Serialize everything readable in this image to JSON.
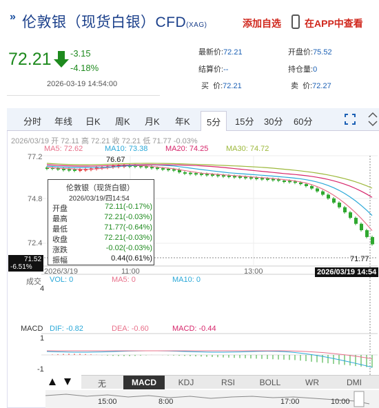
{
  "header": {
    "chevron": "»",
    "title": "伦敦银（现货白银）CFD",
    "title_suffix": "(XAG)",
    "add_fav": "添加自选",
    "app_view": "在APP中查看"
  },
  "quote": {
    "price": "72.21",
    "change": "-3.15",
    "change_pct": "-4.18%",
    "timestamp": "2026-03-19 14:54:00"
  },
  "stats": {
    "latest_label": "最新价:",
    "latest": "72.21",
    "open_label": "开盘价:",
    "open": "75.52",
    "settle_label": "结算价:",
    "settle": "--",
    "oi_label": "持仓量:",
    "oi": "0",
    "buy_label": "买  价:",
    "buy": "72.21",
    "sell_label": "卖  价:",
    "sell": "72.27"
  },
  "tabs": [
    "分时",
    "年线",
    "日K",
    "周K",
    "月K",
    "年K",
    "5分",
    "15分",
    "30分",
    "60分"
  ],
  "active_tab": "5分",
  "info_line": "2026/03/19  开 72.11  高 72.21  收 72.21  低 71.77  -0.03%",
  "ma": {
    "ma5": "MA5: 72.62",
    "ma10": "MA10: 73.38",
    "ma20": "MA20: 74.25",
    "ma30": "MA30: 74.72"
  },
  "colors": {
    "ma5": "#e8708a",
    "ma10": "#2aa8d8",
    "ma20": "#d6256a",
    "ma30": "#9cb83a",
    "up": "#e0231f",
    "down": "#2fa82f"
  },
  "price_axis": [
    "77.2",
    "74.8",
    "72.4"
  ],
  "high_marker": "76.67",
  "low_marker": "71.77",
  "cursor_price": "71.52",
  "cursor_pct": "-6.51%",
  "cursor_time": "2026/03/19 14:54",
  "x_axis": [
    "2026/3/19",
    "11:00",
    "13:00"
  ],
  "tooltip": {
    "name": "伦敦银（现货白银）",
    "date": "2026/03/19/四14:54",
    "rows": [
      {
        "k": "开盘",
        "v": "72.11(-0.17%)"
      },
      {
        "k": "最高",
        "v": "72.21(-0.03%)"
      },
      {
        "k": "最低",
        "v": "71.77(-0.64%)"
      },
      {
        "k": "收盘",
        "v": "72.21(-0.03%)"
      },
      {
        "k": "涨跌",
        "v": "-0.02(-0.03%)"
      },
      {
        "k": "振幅",
        "v": "0.44(0.61%)"
      }
    ]
  },
  "volume": {
    "label": "成交",
    "vol": "VOL: 0",
    "ma5": "MA5: 0",
    "ma10": "MA10: 0",
    "axis_top": "4"
  },
  "macd": {
    "label": "MACD",
    "dif": "DIF: -0.82",
    "dea": "DEA: -0.60",
    "macd": "MACD: -0.44",
    "axis_top": "1",
    "axis_bottom": "-1"
  },
  "indicator_buttons": [
    "无",
    "MACD",
    "KDJ",
    "RSI",
    "BOLL",
    "WR",
    "DMI"
  ],
  "active_indicator": "MACD",
  "timeline": [
    "15:00",
    "8:00",
    "17:00",
    "10:00"
  ]
}
